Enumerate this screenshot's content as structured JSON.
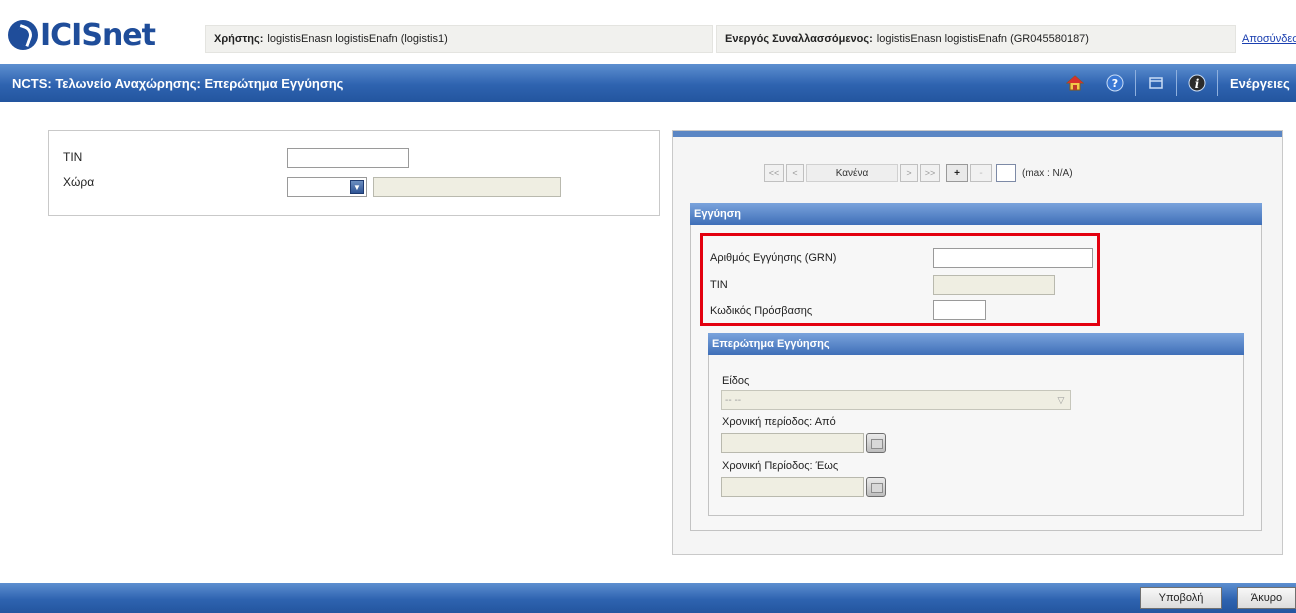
{
  "app": {
    "logo_text": "ICISnet"
  },
  "header": {
    "user_label": "Χρήστης:",
    "user_value": "logistisEnasn logistisEnafn (logistis1)",
    "trader_label": "Ενεργός Συναλλασσόμενος:",
    "trader_value": "logistisEnasn logistisEnafn (GR045580187)",
    "logout_label": "Αποσύνδεση"
  },
  "titlebar": {
    "title": "NCTS: Τελωνείο Αναχώρησης: Επερώτημα Εγγύησης",
    "right_text": "Ενέργειες",
    "icons": [
      "home-icon",
      "help-icon",
      "window-icon",
      "info-icon"
    ]
  },
  "left_form": {
    "tin_label": "TIN",
    "tin_value": "",
    "country_label": "Χώρα",
    "country_value": "",
    "country_name_value": ""
  },
  "pager": {
    "first": "<<",
    "prev": "<",
    "current": "Κανένα",
    "next": ">",
    "last": ">>",
    "add": "+",
    "remove": "-",
    "max_text": "(max : N/A)"
  },
  "guarantee": {
    "section_title": "Εγγύηση",
    "grn_label": "Αριθμός Εγγύησης (GRN)",
    "grn_value": "",
    "tin_label": "TIN",
    "tin_value": "",
    "access_code_label": "Κωδικός Πρόσβασης",
    "access_code_value": ""
  },
  "query": {
    "section_title": "Επερώτημα Εγγύησης",
    "type_label": "Είδος",
    "type_value": "-- --",
    "from_label": "Χρονική περίοδος: Από",
    "from_value": "",
    "to_label": "Χρονική Περίοδος: Έως",
    "to_value": ""
  },
  "footer": {
    "submit_label": "Υποβολή",
    "cancel_label": "Άκυρο"
  },
  "colors": {
    "brand_blue": "#2e63b0",
    "highlight_red": "#e3000f",
    "readonly_bg": "#efeee2"
  }
}
